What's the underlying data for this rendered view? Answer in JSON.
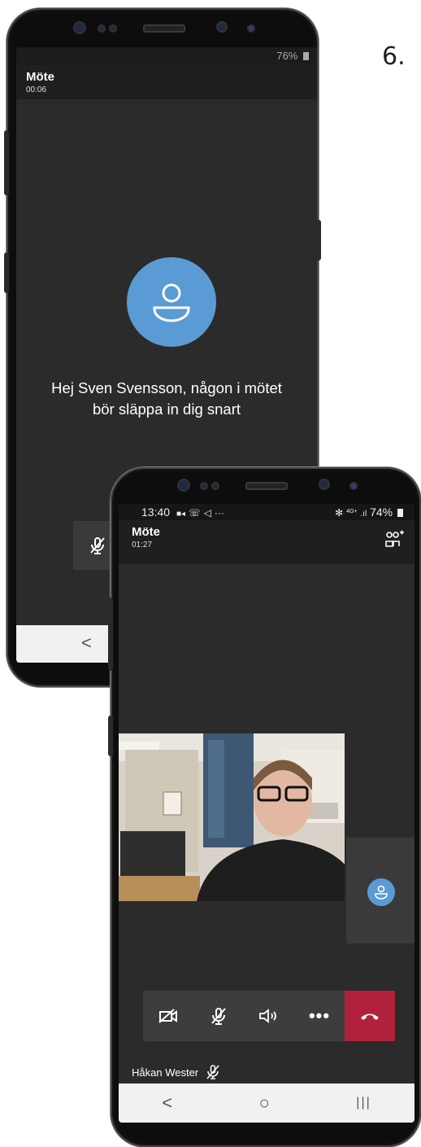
{
  "step": "6.",
  "phone1": {
    "battery": "76%",
    "title": "Möte",
    "elapsed": "00:06",
    "lobby_message_line1": "Hej Sven Svensson, någon i mötet",
    "lobby_message_line2": "bör släppa in dig snart",
    "nav_back": "<"
  },
  "phone2": {
    "status_time": "13:40",
    "status_signal": "4G+",
    "battery": "74%",
    "title": "Möte",
    "elapsed": "01:27",
    "participant_name": "Håkan Wester",
    "nav": {
      "back": "<",
      "home": "○",
      "recents": "|||"
    }
  },
  "colors": {
    "end_call": "#b2213b",
    "avatar": "#5b9bd5",
    "background": "#2b2b2b"
  }
}
